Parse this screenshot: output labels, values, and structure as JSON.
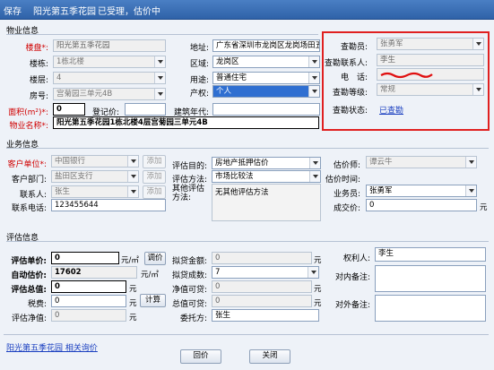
{
  "titlebar": {
    "save": "保存",
    "property_name": "阳光第五季花园",
    "status": "已受理，估价中"
  },
  "property_section": {
    "title": "物业信息",
    "plate_label": "楼盘*:",
    "plate_value": "阳光第五季花园",
    "building_label": "楼栋:",
    "building_value": "1栋北楼",
    "floor_label": "楼层:",
    "floor_value": "4",
    "room_label": "房号:",
    "room_value": "宫菊园三单元4B",
    "area_label": "面积(m²)*:",
    "area_value": "0",
    "register_price_label": "登记价:",
    "register_price_value": "",
    "name_label": "物业名称*:",
    "name_value": "阳光第五季花园1栋北楼4层宫菊园三单元4B",
    "address_label": "地址:",
    "address_value": "广东省深圳市龙岗区龙岗场田五和",
    "district_label": "区域:",
    "district_value": "龙岗区",
    "usage_label": "用途:",
    "usage_value": "普通住宅",
    "ownership_label": "产权:",
    "ownership_value": "个人",
    "build_year_label": "建筑年代:",
    "build_year_value": ""
  },
  "survey_box": {
    "surveyor_label": "查勘员:",
    "surveyor_value": "张勇军",
    "contact_label": "查勘联系人:",
    "contact_value": "李生",
    "phone_label": "电　话:",
    "phone_value": "",
    "level_label": "查勘等级:",
    "level_value": "常规",
    "status_label": "查勘状态:",
    "status_value": "已查勘"
  },
  "business_section": {
    "title": "业务信息",
    "client_label": "客户单位*:",
    "client_value": "中国银行",
    "dept_label": "客户部门:",
    "dept_value": "盐田区支行",
    "contact_label": "联系人:",
    "contact_value": "张生",
    "phone_label": "联系电话:",
    "phone_value": "123455644",
    "add_label": "添加",
    "purpose_label": "评估目的:",
    "purpose_value": "房地产抵押估价",
    "method_label": "评估方法:",
    "method_value": "市场比较法",
    "other_method_label": "其他评估方法:",
    "other_method_value": "无其他评估方法",
    "appraiser_label": "估价师:",
    "appraiser_value": "谭云牛",
    "appraise_time_label": "估价时间:",
    "appraise_time_value": "",
    "salesman_label": "业务员:",
    "salesman_value": "张勇军",
    "deal_price_label": "成交价:",
    "deal_price_value": "0",
    "deal_price_unit": "元"
  },
  "valuation_section": {
    "title": "评估信息",
    "unit_price_label": "评估单价:",
    "unit_price_value": "0",
    "unit_price_unit": "元/㎡",
    "adjust_button": "调价",
    "auto_price_label": "自动估价:",
    "auto_price_value": "17602",
    "auto_price_unit": "元/㎡",
    "total_label": "评估总值:",
    "total_value": "0",
    "total_unit": "元",
    "tax_label": "税费:",
    "tax_value": "0",
    "tax_unit": "元",
    "calc_button": "计算",
    "net_label": "评估净值:",
    "net_value": "0",
    "net_unit": "元",
    "loan_amount_label": "拟贷金额:",
    "loan_amount_value": "0",
    "loan_amount_unit": "元",
    "loan_ratio_label": "拟贷成数:",
    "loan_ratio_value": "7",
    "net_loan_label": "净值可贷:",
    "net_loan_value": "0",
    "net_loan_unit": "元",
    "total_loan_label": "总值可贷:",
    "total_loan_value": "0",
    "total_loan_unit": "元",
    "delegate_label": "委托方:",
    "delegate_value": "张生",
    "owner_label": "权利人:",
    "owner_value": "李生",
    "internal_note_label": "对内备注:",
    "internal_note_value": "",
    "external_note_label": "对外备注:",
    "external_note_value": ""
  },
  "footer": {
    "link_text": "阳光第五季花园 相关询价",
    "reply_button": "回价",
    "close_button": "关闭"
  }
}
